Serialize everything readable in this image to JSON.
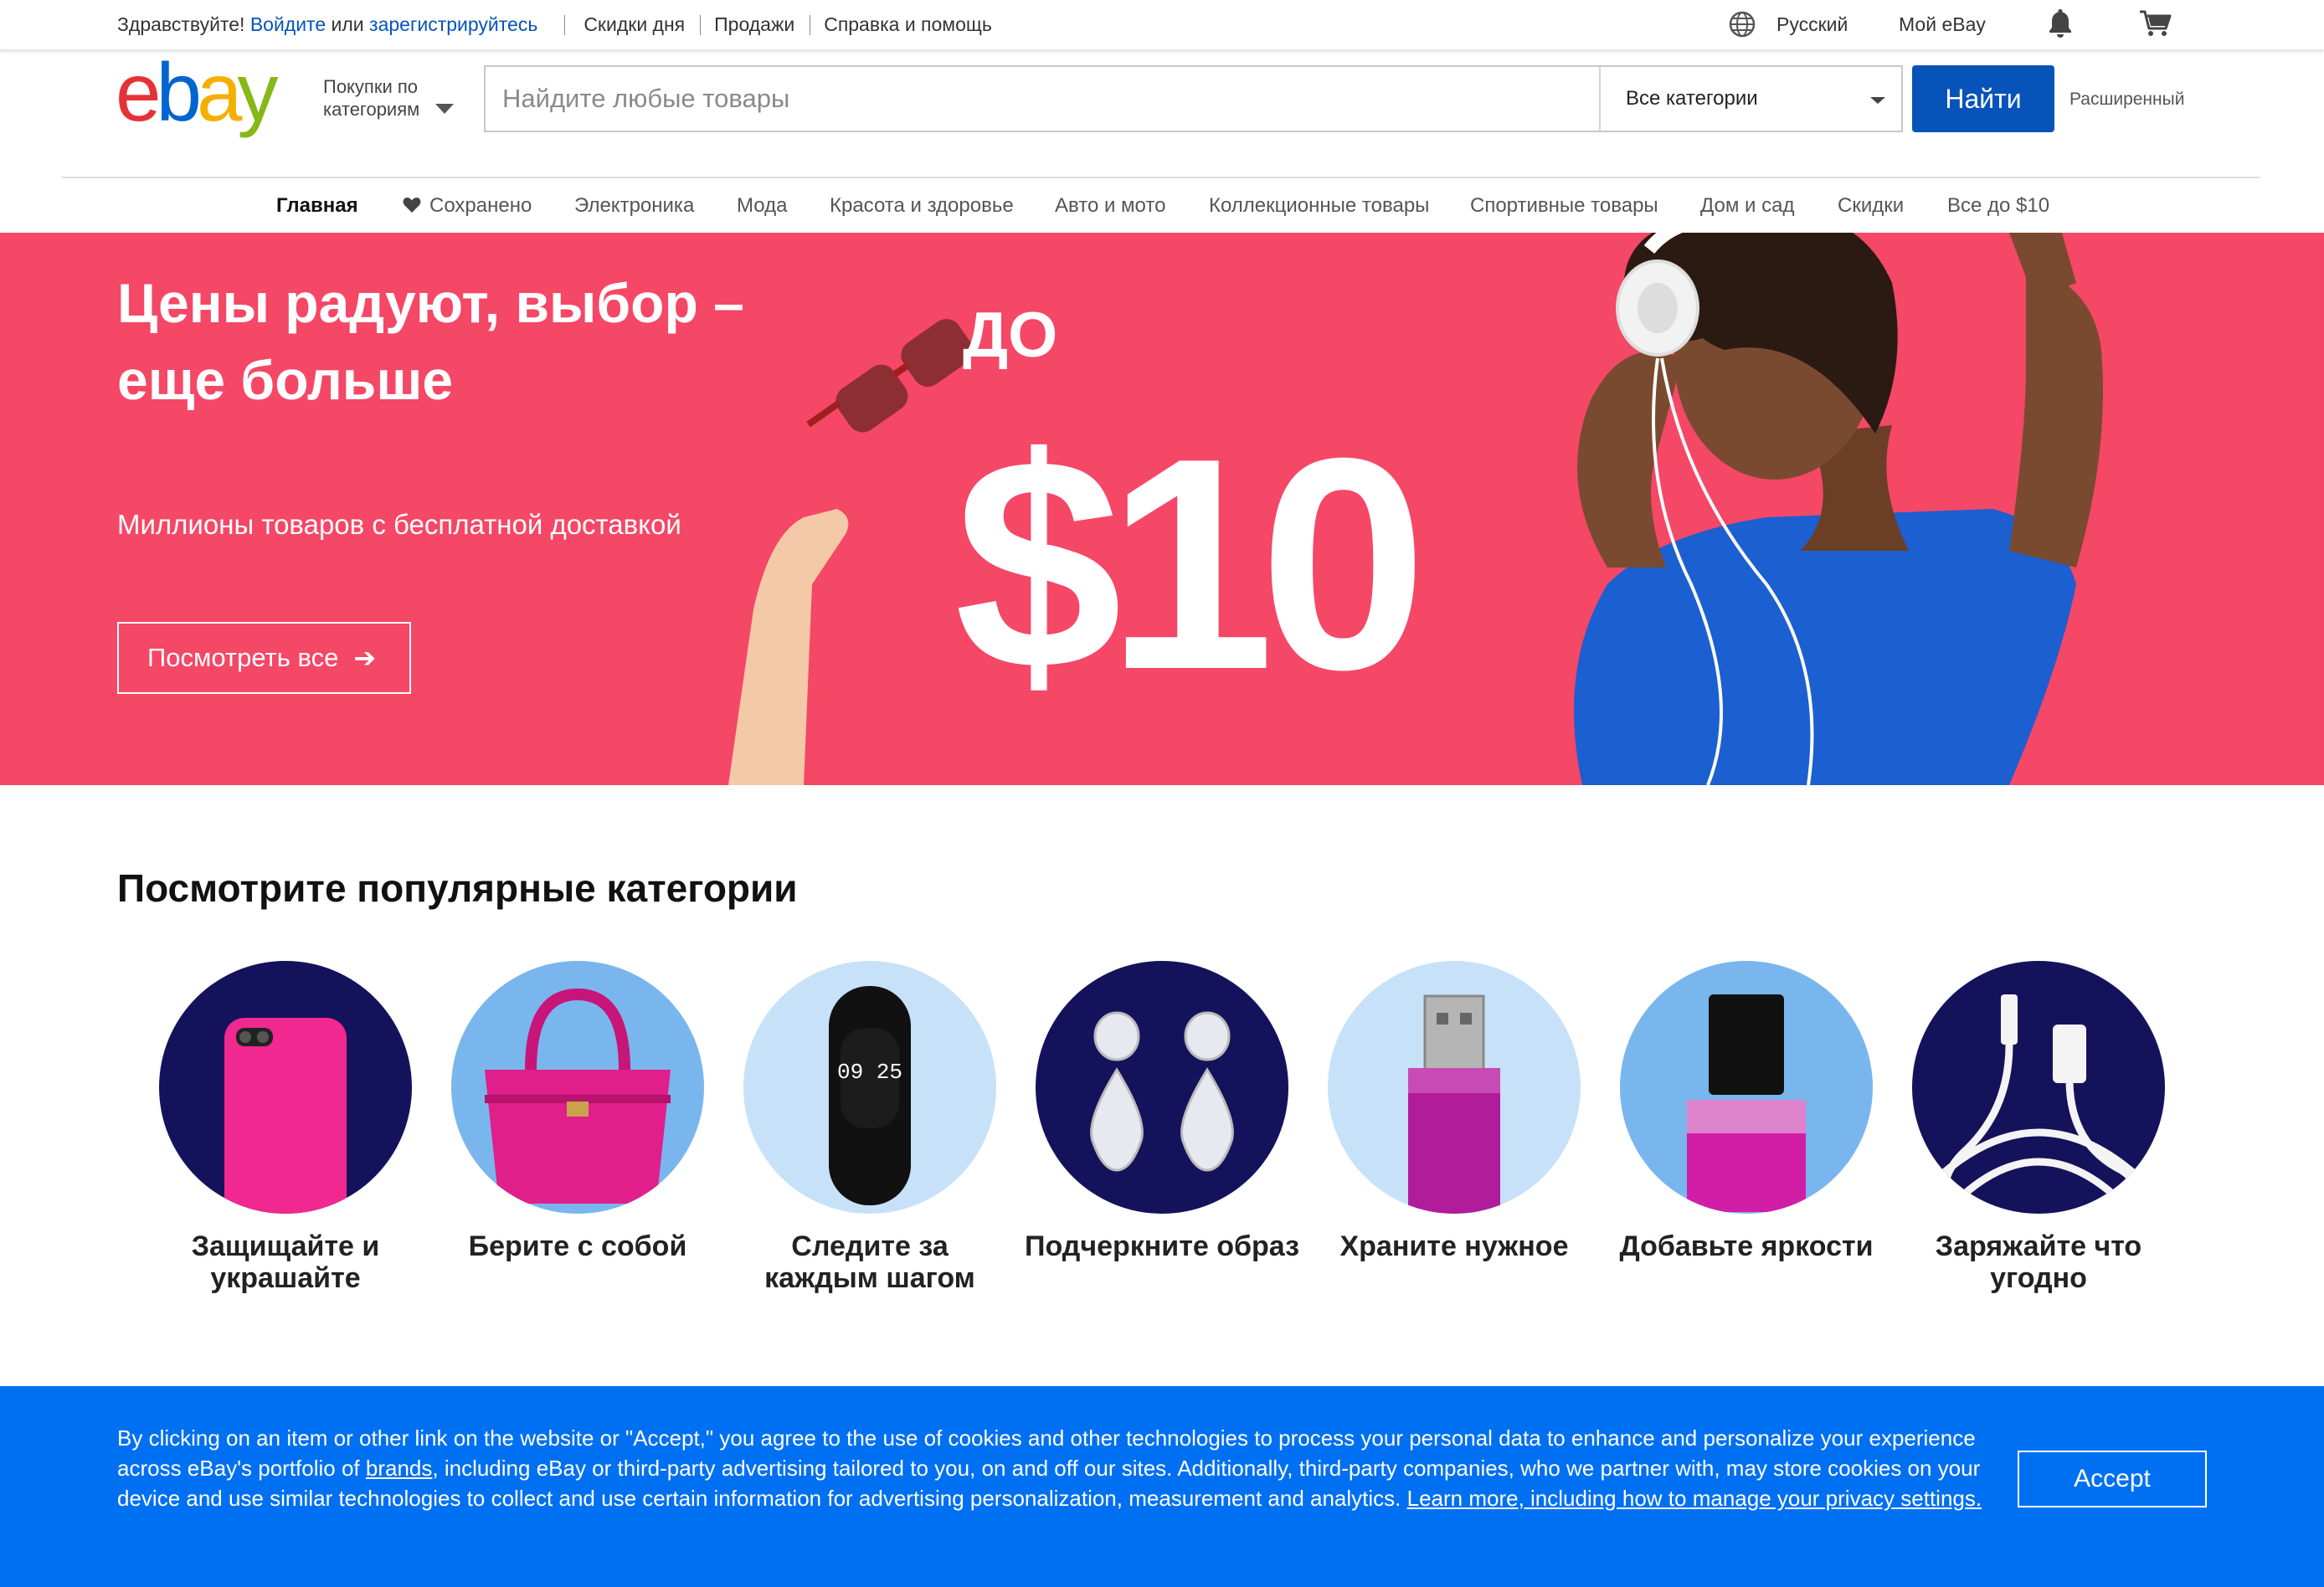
{
  "topbar": {
    "greeting": "Здравствуйте!",
    "signin": "Войдите",
    "or": "или",
    "register": "зарегистрируйтесь",
    "links": [
      "Скидки дня",
      "Продажи",
      "Справка и помощь"
    ],
    "language": "Русский",
    "my_ebay": "Мой eBay",
    "icons": [
      "globe-icon",
      "bell-icon",
      "cart-icon"
    ]
  },
  "header": {
    "logo_text": "ebay",
    "shop_by_line1": "Покупки по",
    "shop_by_line2": "категориям",
    "search_placeholder": "Найдите любые товары",
    "category_select": "Все категории",
    "search_button": "Найти",
    "advanced": "Расширенный"
  },
  "nav": {
    "items": [
      "Главная",
      "Сохранено",
      "Электроника",
      "Мода",
      "Красота и здоровье",
      "Авто и мото",
      "Коллекционные товары",
      "Спортивные товары",
      "Дом и сад",
      "Скидки",
      "Все до $10"
    ],
    "active": "Главная"
  },
  "hero": {
    "title": "Цены радуют, выбор – еще больше",
    "subtitle": "Миллионы товаров с бесплатной доставкой",
    "button": "Посмотреть все",
    "price_prefix": "ДО",
    "price": "$10",
    "background": "#f54766"
  },
  "categories": {
    "title": "Посмотрите популярные категории",
    "items": [
      {
        "label": "Защищайте и украшайте",
        "icon": "phone-case-icon"
      },
      {
        "label": "Берите с собой",
        "icon": "handbag-icon"
      },
      {
        "label": "Следите за каждым шагом",
        "icon": "fitness-tracker-icon"
      },
      {
        "label": "Подчеркните образ",
        "icon": "earrings-icon"
      },
      {
        "label": "Храните нужное",
        "icon": "usb-drive-icon"
      },
      {
        "label": "Добавьте яркости",
        "icon": "nail-polish-icon"
      },
      {
        "label": "Заряжайте что угодно",
        "icon": "charging-cable-icon"
      }
    ],
    "tracker_time": "09 25"
  },
  "cookie": {
    "text_1": "By clicking on an item or other link on the website or \"Accept,\" you agree to the use of cookies and other technologies to process your personal data to enhance and personalize your experience across eBay's portfolio of ",
    "brands_link": "brands",
    "text_2": ", including eBay or third-party advertising tailored to you, on and off our sites. Additionally, third-party companies, who we partner with, may store cookies on your device and use similar technologies to collect and use certain information for advertising personalization, measurement and analytics. ",
    "learn_more_link": "Learn more, including how to manage your privacy settings.",
    "accept_button": "Accept",
    "background": "#0070f2"
  }
}
